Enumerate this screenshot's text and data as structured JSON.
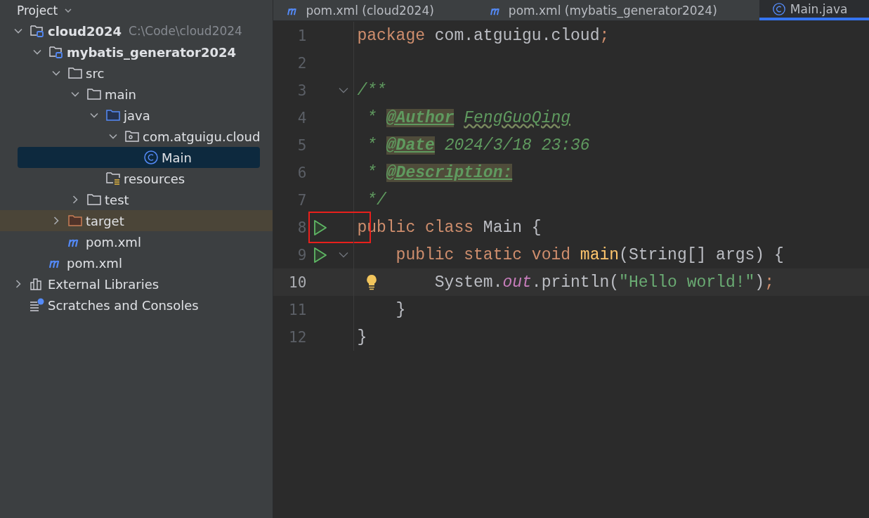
{
  "sidebar": {
    "title": "Project",
    "tree": [
      {
        "kind": "module",
        "label": "cloud2024",
        "hint": "C:\\Code\\cloud2024",
        "expanded": true,
        "selected": false,
        "children": [
          {
            "kind": "module",
            "label": "mybatis_generator2024",
            "expanded": true,
            "selected": false,
            "children": [
              {
                "kind": "folder",
                "label": "src",
                "expanded": true,
                "selected": false,
                "children": [
                  {
                    "kind": "folder",
                    "label": "main",
                    "expanded": true,
                    "selected": false,
                    "children": [
                      {
                        "kind": "source",
                        "label": "java",
                        "expanded": true,
                        "selected": false,
                        "children": [
                          {
                            "kind": "package",
                            "label": "com.atguigu.cloud",
                            "expanded": true,
                            "selected": false,
                            "children": [
                              {
                                "kind": "class",
                                "label": "Main",
                                "selected": true
                              }
                            ]
                          }
                        ]
                      },
                      {
                        "kind": "resources",
                        "label": "resources",
                        "selected": false
                      }
                    ]
                  },
                  {
                    "kind": "folder",
                    "label": "test",
                    "expanded": false,
                    "selected": false
                  }
                ]
              },
              {
                "kind": "excluded",
                "label": "target",
                "expanded": false,
                "selected": false
              },
              {
                "kind": "maven",
                "label": "pom.xml",
                "selected": false
              }
            ]
          },
          {
            "kind": "maven",
            "label": "pom.xml",
            "selected": false
          }
        ]
      },
      {
        "kind": "libraries",
        "label": "External Libraries",
        "expanded": false,
        "selected": false
      },
      {
        "kind": "scratches",
        "label": "Scratches and Consoles",
        "selected": false
      }
    ]
  },
  "tabs": [
    {
      "kind": "maven",
      "label": "pom.xml (cloud2024)",
      "selected": false
    },
    {
      "kind": "maven",
      "label": "pom.xml (mybatis_generator2024)",
      "selected": false
    },
    {
      "kind": "class",
      "label": "Main.java",
      "selected": true
    }
  ],
  "editor": {
    "lines": [
      {
        "number": "1",
        "tokens": [
          {
            "kind": "keyword",
            "text": "package "
          },
          {
            "kind": "plain",
            "text": "com.atguigu.cloud"
          },
          {
            "kind": "keyword",
            "text": ";"
          }
        ]
      },
      {
        "number": "2"
      },
      {
        "number": "3",
        "fold": true,
        "tokens": [
          {
            "kind": "comment",
            "text": "/**"
          }
        ]
      },
      {
        "number": "4",
        "tokens": [
          {
            "kind": "comment",
            "text": " * "
          },
          {
            "kind": "tag",
            "text": "@Author"
          },
          {
            "kind": "typo",
            "text": "FengGuoQing"
          }
        ]
      },
      {
        "number": "5",
        "tokens": [
          {
            "kind": "comment",
            "text": " * "
          },
          {
            "kind": "tag",
            "text": "@Date"
          },
          {
            "kind": "comment",
            "text": " 2024/3/18 23:36"
          }
        ]
      },
      {
        "number": "6",
        "tokens": [
          {
            "kind": "comment",
            "text": " * "
          },
          {
            "kind": "tag",
            "text": "@Description:"
          }
        ]
      },
      {
        "number": "7",
        "tokens": [
          {
            "kind": "comment",
            "text": " */"
          }
        ]
      },
      {
        "number": "8",
        "run": true,
        "marked": true,
        "tokens": [
          {
            "kind": "keyword",
            "text": "public class "
          },
          {
            "kind": "plain",
            "text": "Main {"
          }
        ]
      },
      {
        "number": "9",
        "run": true,
        "fold": true,
        "tokens": [
          {
            "kind": "keyword",
            "text": "    public static void "
          },
          {
            "kind": "method",
            "text": "main"
          },
          {
            "kind": "plain",
            "text": "(String[] args) {"
          }
        ]
      },
      {
        "number": "10",
        "current": true,
        "intention": true,
        "tokens": [
          {
            "kind": "plain",
            "text": "        System."
          },
          {
            "kind": "field",
            "text": "out"
          },
          {
            "kind": "plain",
            "text": ".println("
          },
          {
            "kind": "string",
            "text": "\"Hello world!\""
          },
          {
            "kind": "plain",
            "text": ")"
          },
          {
            "kind": "keyword",
            "text": ";"
          }
        ]
      },
      {
        "number": "11",
        "tokens": [
          {
            "kind": "plain",
            "text": "    }"
          }
        ]
      },
      {
        "number": "12",
        "tokens": [
          {
            "kind": "plain",
            "text": "}"
          }
        ]
      }
    ]
  }
}
